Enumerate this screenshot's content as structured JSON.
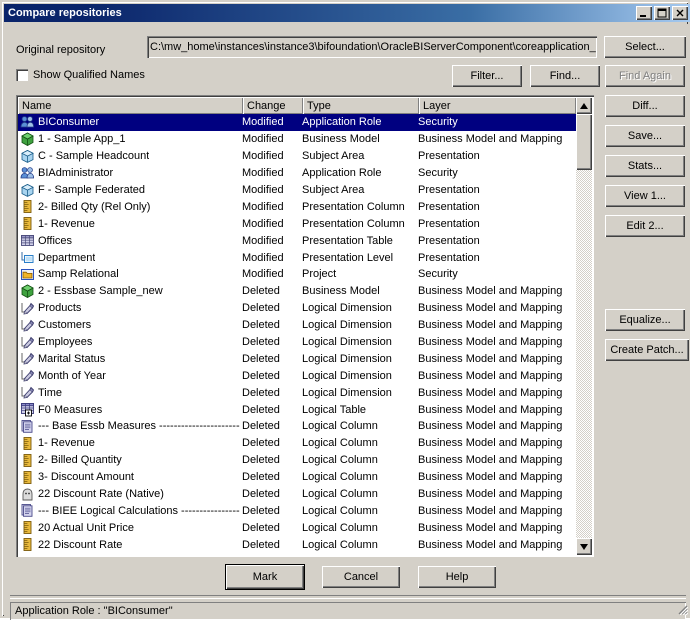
{
  "window": {
    "title": "Compare repositories",
    "minimize_label": "minimize-icon",
    "maximize_label": "maximize-icon",
    "close_label": "close-icon"
  },
  "form": {
    "original_repository_label": "Original repository",
    "original_repository_value": "C:\\mw_home\\instances\\instance3\\bifoundation\\OracleBIServerComponent\\coreapplication_",
    "select_button": "Select...",
    "show_qualified_names_label": "Show Qualified Names",
    "show_qualified_names_checked": false,
    "filter_button": "Filter...",
    "find_button": "Find...",
    "find_again_button": "Find Again",
    "find_again_disabled": true
  },
  "side_buttons": [
    {
      "label": "Diff...",
      "disabled": false
    },
    {
      "label": "Save...",
      "disabled": false
    },
    {
      "label": "Stats...",
      "disabled": false
    },
    {
      "label": "View 1...",
      "disabled": false
    },
    {
      "label": "Edit 2...",
      "disabled": false
    }
  ],
  "side_buttons_bottom": [
    {
      "label": "Equalize...",
      "disabled": false
    },
    {
      "label": "Create Patch...",
      "disabled": false
    }
  ],
  "table": {
    "columns": [
      "Name",
      "Change",
      "Type",
      "Layer"
    ],
    "rows": [
      {
        "icon": "application-role-icon",
        "name": "BIConsumer",
        "change": "Modified",
        "type": "Application Role",
        "layer": "Security",
        "selected": true
      },
      {
        "icon": "business-model-icon",
        "name": "1 - Sample App_1",
        "change": "Modified",
        "type": "Business Model",
        "layer": "Business Model and Mapping",
        "selected": false
      },
      {
        "icon": "subject-area-icon",
        "name": "C - Sample Headcount",
        "change": "Modified",
        "type": "Subject Area",
        "layer": "Presentation",
        "selected": false
      },
      {
        "icon": "application-role-icon",
        "name": "BIAdministrator",
        "change": "Modified",
        "type": "Application Role",
        "layer": "Security",
        "selected": false
      },
      {
        "icon": "subject-area-icon",
        "name": "F - Sample Federated",
        "change": "Modified",
        "type": "Subject Area",
        "layer": "Presentation",
        "selected": false
      },
      {
        "icon": "column-icon",
        "name": "2- Billed Qty (Rel Only)",
        "change": "Modified",
        "type": "Presentation Column",
        "layer": "Presentation",
        "selected": false
      },
      {
        "icon": "column-icon",
        "name": "1- Revenue",
        "change": "Modified",
        "type": "Presentation Column",
        "layer": "Presentation",
        "selected": false
      },
      {
        "icon": "presentation-table-icon",
        "name": "Offices",
        "change": "Modified",
        "type": "Presentation Table",
        "layer": "Presentation",
        "selected": false
      },
      {
        "icon": "presentation-level-icon",
        "name": "Department",
        "change": "Modified",
        "type": "Presentation Level",
        "layer": "Presentation",
        "selected": false
      },
      {
        "icon": "project-icon",
        "name": "Samp Relational",
        "change": "Modified",
        "type": "Project",
        "layer": "Security",
        "selected": false
      },
      {
        "icon": "business-model-icon",
        "name": "2 - Essbase Sample_new",
        "change": "Deleted",
        "type": "Business Model",
        "layer": "Business Model and Mapping",
        "selected": false
      },
      {
        "icon": "logical-dimension-icon",
        "name": "Products",
        "change": "Deleted",
        "type": "Logical Dimension",
        "layer": "Business Model and Mapping",
        "selected": false
      },
      {
        "icon": "logical-dimension-icon",
        "name": "Customers",
        "change": "Deleted",
        "type": "Logical Dimension",
        "layer": "Business Model and Mapping",
        "selected": false
      },
      {
        "icon": "logical-dimension-icon",
        "name": "Employees",
        "change": "Deleted",
        "type": "Logical Dimension",
        "layer": "Business Model and Mapping",
        "selected": false
      },
      {
        "icon": "logical-dimension-icon",
        "name": "Marital Status",
        "change": "Deleted",
        "type": "Logical Dimension",
        "layer": "Business Model and Mapping",
        "selected": false
      },
      {
        "icon": "logical-dimension-icon",
        "name": "Month of Year",
        "change": "Deleted",
        "type": "Logical Dimension",
        "layer": "Business Model and Mapping",
        "selected": false
      },
      {
        "icon": "logical-dimension-icon",
        "name": "Time",
        "change": "Deleted",
        "type": "Logical Dimension",
        "layer": "Business Model and Mapping",
        "selected": false
      },
      {
        "icon": "logical-table-icon",
        "name": "F0 Measures",
        "change": "Deleted",
        "type": "Logical Table",
        "layer": "Business Model and Mapping",
        "selected": false
      },
      {
        "icon": "folder-group-icon",
        "name": "--- Base Essb Measures ------------------------",
        "change": "Deleted",
        "type": "Logical Column",
        "layer": "Business Model and Mapping",
        "selected": false
      },
      {
        "icon": "column-icon",
        "name": "1- Revenue",
        "change": "Deleted",
        "type": "Logical Column",
        "layer": "Business Model and Mapping",
        "selected": false
      },
      {
        "icon": "column-icon",
        "name": "2- Billed Quantity",
        "change": "Deleted",
        "type": "Logical Column",
        "layer": "Business Model and Mapping",
        "selected": false
      },
      {
        "icon": "column-icon",
        "name": "3- Discount Amount",
        "change": "Deleted",
        "type": "Logical Column",
        "layer": "Business Model and Mapping",
        "selected": false
      },
      {
        "icon": "derived-column-icon",
        "name": "22  Discount Rate (Native)",
        "change": "Deleted",
        "type": "Logical Column",
        "layer": "Business Model and Mapping",
        "selected": false
      },
      {
        "icon": "folder-group-icon",
        "name": "--- BIEE Logical Calculations ----------------",
        "change": "Deleted",
        "type": "Logical Column",
        "layer": "Business Model and Mapping",
        "selected": false
      },
      {
        "icon": "column-icon",
        "name": "20  Actual Unit Price",
        "change": "Deleted",
        "type": "Logical Column",
        "layer": "Business Model and Mapping",
        "selected": false
      },
      {
        "icon": "column-icon",
        "name": "22  Discount Rate",
        "change": "Deleted",
        "type": "Logical Column",
        "layer": "Business Model and Mapping",
        "selected": false
      }
    ]
  },
  "footer": {
    "mark_button": "Mark",
    "cancel_button": "Cancel",
    "help_button": "Help"
  },
  "statusbar": {
    "text": "Application Role : \"BIConsumer\""
  },
  "colors": {
    "titlebar_start": "#0a246a",
    "titlebar_end": "#a6caf0",
    "face": "#d4d0c8",
    "selection": "#000080",
    "disabled_text": "#808080"
  }
}
